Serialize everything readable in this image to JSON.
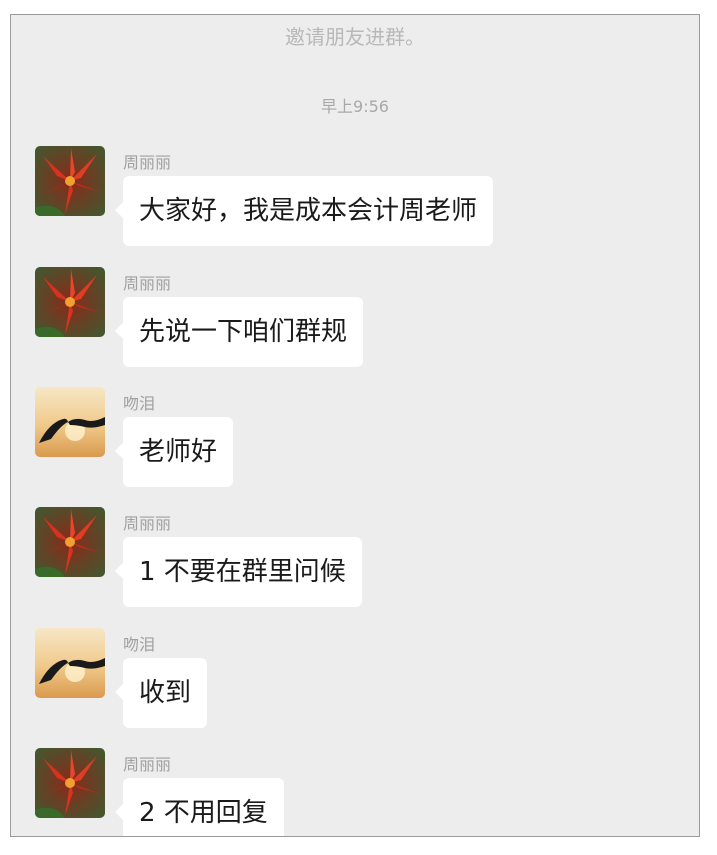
{
  "chat": {
    "system_invite": "邀请朋友进群。",
    "timestamp": "早上9:56",
    "messages": [
      {
        "sender": "周丽丽",
        "avatar": "red-flower-avatar",
        "text": "大家好，我是成本会计周老师"
      },
      {
        "sender": "周丽丽",
        "avatar": "red-flower-avatar",
        "text": "先说一下咱们群规"
      },
      {
        "sender": "吻泪",
        "avatar": "sunset-hands-avatar",
        "text": "老师好"
      },
      {
        "sender": "周丽丽",
        "avatar": "red-flower-avatar",
        "text": "1 不要在群里问候"
      },
      {
        "sender": "吻泪",
        "avatar": "sunset-hands-avatar",
        "text": "收到"
      },
      {
        "sender": "周丽丽",
        "avatar": "red-flower-avatar",
        "text": "2 不用回复"
      }
    ]
  },
  "colors": {
    "chat_background": "#ededed",
    "bubble_background": "#ffffff",
    "sender_name": "#a0a0a0",
    "system_text": "#b8b8b8"
  }
}
